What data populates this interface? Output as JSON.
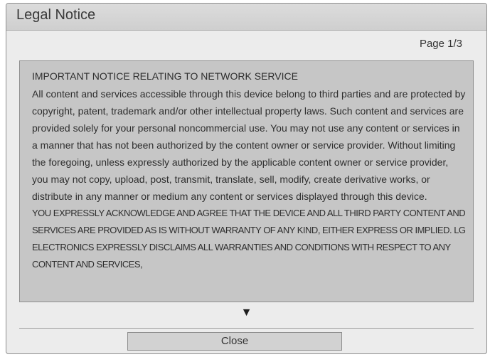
{
  "dialog": {
    "title": "Legal Notice",
    "page_indicator": "Page 1/3",
    "content": {
      "heading": "IMPORTANT NOTICE RELATING TO NETWORK SERVICE",
      "paragraph": "All content and services accessible through this device belong to third parties and are protected by copyright, patent, trademark and/or other intellectual property laws. Such content and services are provided solely for your personal noncommercial use. You may not use any content or services in a manner that has not been authorized by the content owner or service provider. Without limiting the foregoing, unless expressly authorized by the applicable content owner or service provider, you may not copy, upload, post, transmit, translate, sell, modify, create derivative works, or distribute in any manner or medium any content or services displayed through this device.",
      "caps_paragraph": "YOU EXPRESSLY ACKNOWLEDGE AND AGREE THAT THE DEVICE AND ALL THIRD PARTY CONTENT AND SERVICES ARE PROVIDED AS IS WITHOUT WARRANTY OF ANY KIND, EITHER EXPRESS OR IMPLIED. LG ELECTRONICS EXPRESSLY DISCLAIMS ALL WARRANTIES AND CONDITIONS WITH RESPECT TO ANY CONTENT AND SERVICES,"
    },
    "scroll_indicator": "▼",
    "close_label": "Close"
  }
}
